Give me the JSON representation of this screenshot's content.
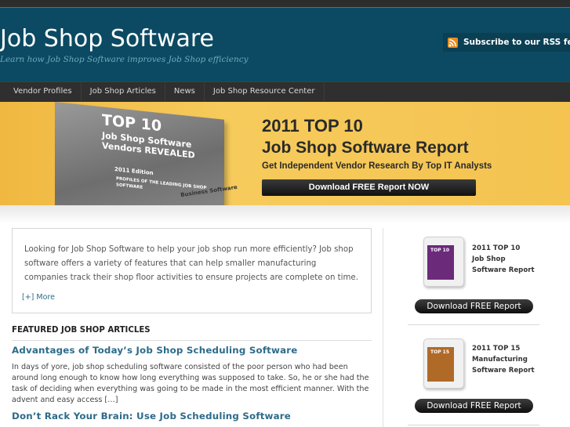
{
  "header": {
    "title": "Job Shop Software",
    "tagline": "Learn how Job Shop Software improves Job Shop efficiency",
    "rss_label": "Subscribe to our RSS feed",
    "rss_icon": "rss-icon"
  },
  "nav": {
    "items": [
      {
        "label": "Vendor Profiles"
      },
      {
        "label": "Job Shop Articles"
      },
      {
        "label": "News"
      },
      {
        "label": "Job Shop Resource Center"
      }
    ]
  },
  "banner": {
    "book_top": "TOP 10",
    "book_subtitle": "Job Shop Software Vendors REVEALED",
    "book_edition": "2011 Edition",
    "book_profiles": "PROFILES OF THE LEADING JOB SHOP SOFTWARE",
    "book_brand": "Business Software",
    "year_line": "2011 TOP 10",
    "title_line": "Job Shop Software Report",
    "subtitle_line": "Get Independent Vendor Research By Top IT Analysts",
    "button_label": "Download FREE Report NOW",
    "colors": {
      "background": "#f4c24a",
      "button": "#1a1a1a"
    }
  },
  "intro": {
    "text": "Looking for Job Shop Software to help your job shop run more efficiently? Job shop software offers a variety of features that can help smaller manufacturing companies track their shop floor activities to ensure projects are complete on time.",
    "more_label": "[+] More"
  },
  "featured": {
    "heading": "FEATURED JOB SHOP ARTICLES",
    "articles": [
      {
        "title": "Advantages of Today’s Job Shop Scheduling Software",
        "excerpt": "In days of yore, job shop scheduling software consisted of the poor person who had been around long enough to know how long everything was supposed to take.  So, he or she had the task of deciding when everything was going to be made in the most efficient manner.  With the advent and easy access […]"
      },
      {
        "title": "Don’t Rack Your Brain: Use Job Scheduling Software"
      }
    ]
  },
  "sidebar": {
    "cards": [
      {
        "book_label": "TOP 10",
        "caption_1": "2011 TOP 10",
        "caption_2": "Job Shop",
        "caption_3": "Software Report",
        "button_label": "Download FREE Report",
        "book_color": "#6b2a7a"
      },
      {
        "book_label": "TOP 15",
        "caption_1": "2011 TOP 15",
        "caption_2": "Manufacturing",
        "caption_3": "Software Report",
        "button_label": "Download FREE Report",
        "book_color": "#b06a28"
      }
    ]
  }
}
